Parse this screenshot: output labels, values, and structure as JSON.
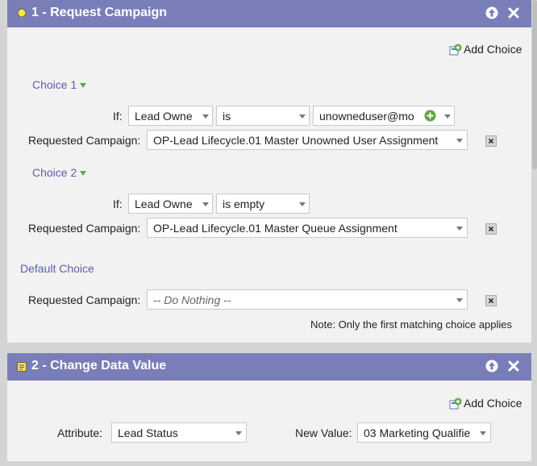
{
  "panel1": {
    "title": "1 - Request Campaign",
    "add_choice": "Add Choice",
    "choice1": {
      "label": "Choice 1",
      "if_label": "If:",
      "field": "Lead Owne",
      "operator": "is",
      "value": "unowneduser@mo",
      "campaign_label": "Requested Campaign:",
      "campaign": "OP-Lead Lifecycle.01 Master Unowned User Assignment"
    },
    "choice2": {
      "label": "Choice 2",
      "if_label": "If:",
      "field": "Lead Owne",
      "operator": "is empty",
      "campaign_label": "Requested Campaign:",
      "campaign": "OP-Lead Lifecycle.01 Master Queue Assignment"
    },
    "default": {
      "label": "Default Choice",
      "campaign_label": "Requested Campaign:",
      "campaign": "-- Do Nothing --"
    },
    "note": "Note: Only the first matching choice applies"
  },
  "panel2": {
    "title": "2 - Change Data Value",
    "add_choice": "Add Choice",
    "attribute_label": "Attribute:",
    "attribute": "Lead Status",
    "new_value_label": "New Value:",
    "new_value": "03 Marketing Qualifie"
  },
  "colors": {
    "header": "#7a7eb8",
    "choice_label": "#5a5fa8",
    "add_icon": "#5ca642"
  }
}
